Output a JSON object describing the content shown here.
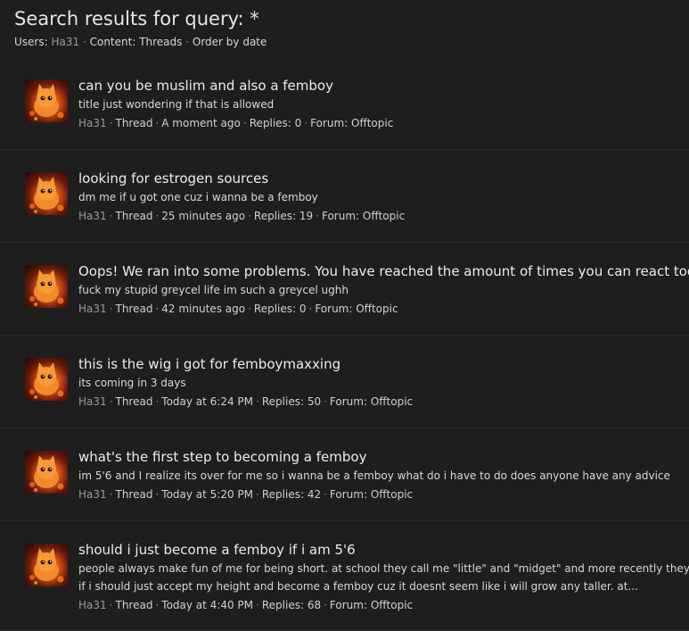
{
  "page": {
    "title": "Search results for query: *",
    "filters": {
      "users_label": "Users:",
      "user": "Ha31",
      "content": "Content: Threads",
      "order": "Order by date"
    }
  },
  "results": [
    {
      "title": "can you be muslim and also a femboy",
      "snippet": [
        "title just wondering if that is allowed"
      ],
      "user": "Ha31",
      "type": "Thread",
      "time": "A moment ago",
      "replies": "Replies: 0",
      "forum": "Forum: Offtopic"
    },
    {
      "title": "looking for estrogen sources",
      "snippet": [
        "dm me if u got one cuz i wanna be a femboy"
      ],
      "user": "Ha31",
      "type": "Thread",
      "time": "25 minutes ago",
      "replies": "Replies: 19",
      "forum": "Forum: Offtopic"
    },
    {
      "title": "Oops! We ran into some problems. You have reached the amount of times you can react today.",
      "snippet": [
        "fuck my stupid greycel life im such a greycel ughh"
      ],
      "user": "Ha31",
      "type": "Thread",
      "time": "42 minutes ago",
      "replies": "Replies: 0",
      "forum": "Forum: Offtopic"
    },
    {
      "title": "this is the wig i got for femboymaxxing",
      "snippet": [
        "its coming in 3 days"
      ],
      "user": "Ha31",
      "type": "Thread",
      "time": "Today at 6:24 PM",
      "replies": "Replies: 50",
      "forum": "Forum: Offtopic"
    },
    {
      "title": "what's the first step to becoming a femboy",
      "snippet": [
        "im 5'6 and I realize its over for me so i wanna be a femboy what do i have to do does anyone have any advice"
      ],
      "user": "Ha31",
      "type": "Thread",
      "time": "Today at 5:20 PM",
      "replies": "Replies: 42",
      "forum": "Forum: Offtopic"
    },
    {
      "title": "should i just become a femboy if i am 5'6",
      "snippet": [
        "people always make fun of me for being short. at school they call me \"little\" and \"midget\" and more recently they started",
        "if i should just accept my height and become a femboy cuz it doesnt seem like i will grow any taller. at..."
      ],
      "user": "Ha31",
      "type": "Thread",
      "time": "Today at 4:40 PM",
      "replies": "Replies: 68",
      "forum": "Forum: Offtopic"
    }
  ]
}
